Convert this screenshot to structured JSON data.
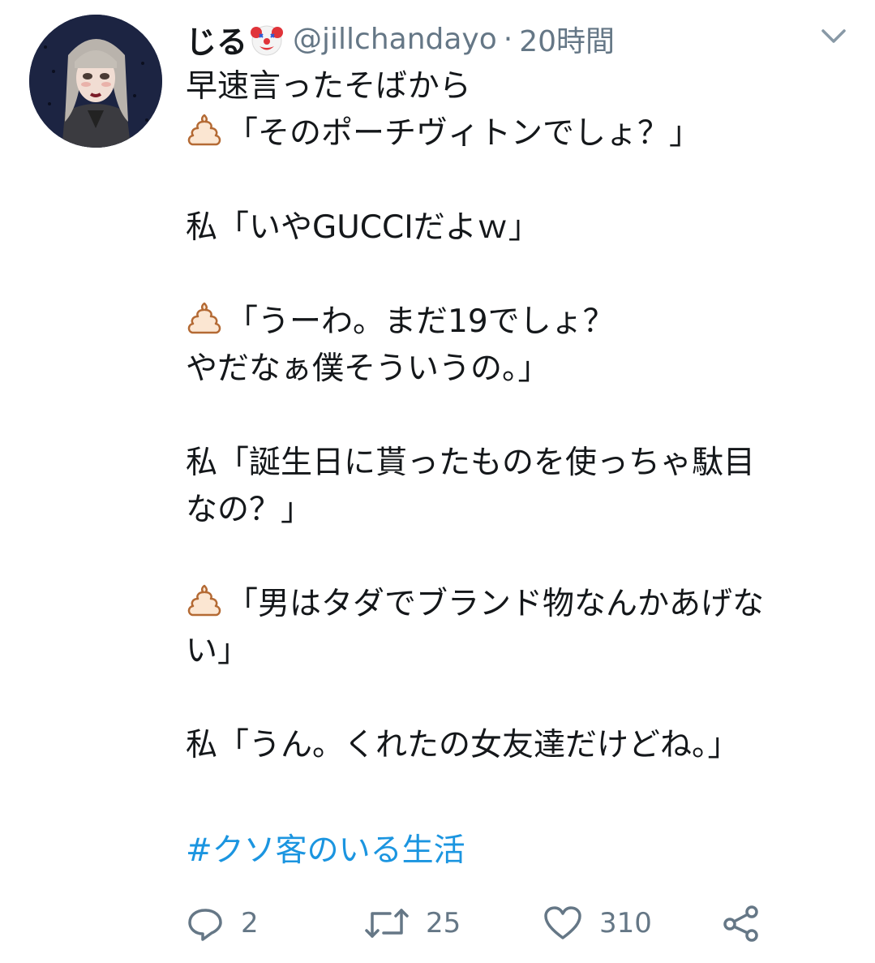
{
  "tweet": {
    "display_name": "じる",
    "handle": "@jillchandayo",
    "separator": "·",
    "timestamp": "20時間",
    "lines": [
      {
        "icon": "",
        "text": "早速言ったそばから"
      },
      {
        "icon": "poop-icon",
        "text": "「そのポーチヴィトンでしょ？」"
      },
      {
        "icon": "",
        "text": ""
      },
      {
        "icon": "",
        "text": "私「いやGUCCIだよｗ」"
      },
      {
        "icon": "",
        "text": ""
      },
      {
        "icon": "poop-icon",
        "text": "「うーわ。まだ19でしょ？"
      },
      {
        "icon": "",
        "text": "やだなぁ僕そういうの。」"
      },
      {
        "icon": "",
        "text": ""
      },
      {
        "icon": "",
        "text": "私「誕生日に貰ったものを使っちゃ駄目"
      },
      {
        "icon": "",
        "text": "なの？」"
      },
      {
        "icon": "",
        "text": ""
      },
      {
        "icon": "poop-icon",
        "text": "「男はタダでブランド物なんかあげな"
      },
      {
        "icon": "",
        "text": "い」"
      },
      {
        "icon": "",
        "text": ""
      },
      {
        "icon": "",
        "text": "私「うん。くれたの女友達だけどね。」"
      }
    ],
    "hashtag": "#クソ客のいる生活",
    "actions": {
      "reply_count": "2",
      "retweet_count": "25",
      "like_count": "310"
    }
  },
  "icons": {
    "name_emoji": "clown-face-icon",
    "speaker_emoji": "poop-icon",
    "menu": "chevron-down-icon",
    "reply": "reply-icon",
    "retweet": "retweet-icon",
    "like": "heart-icon",
    "share": "share-icon"
  },
  "colors": {
    "text": "#14171a",
    "secondary": "#657786",
    "link": "#1b95e0",
    "poop": "#b46a34"
  }
}
